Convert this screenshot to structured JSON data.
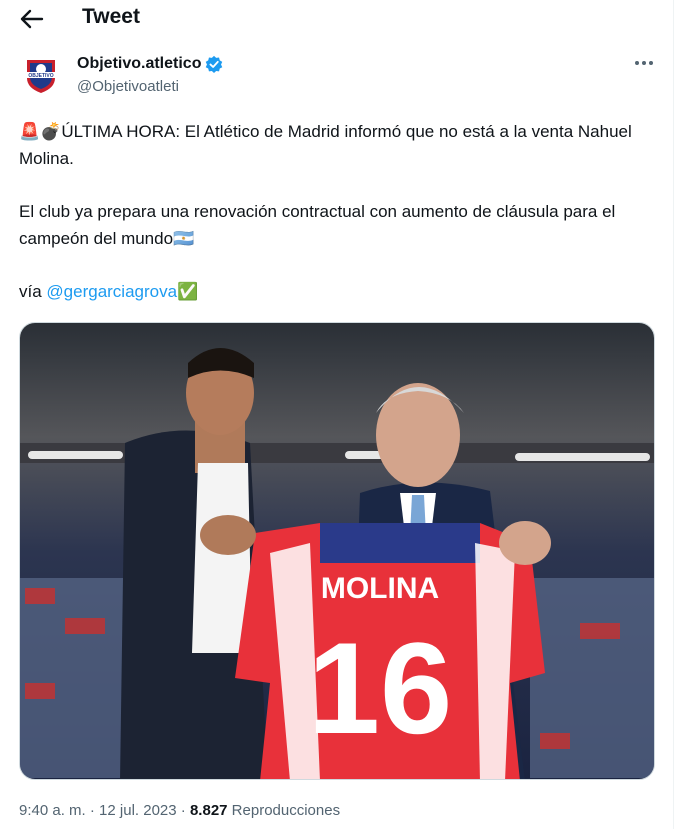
{
  "header": {
    "title": "Tweet",
    "back_icon": "arrow-left-icon"
  },
  "author": {
    "name": "Objetivo.atletico",
    "handle": "@Objetivoatleti",
    "verified_icon": "verified-badge-icon",
    "avatar_text": "OBJETIVO"
  },
  "tweet": {
    "line1_emoji": "🚨💣",
    "line1_text": "ÚLTIMA HORA: El Atlético de Madrid informó que no está a la venta Nahuel Molina.",
    "line2_text": "El club ya prepara una renovación contractual con aumento de cláusula para el campeón del mundo",
    "line2_emoji": "🇦🇷",
    "via_label": "vía ",
    "via_link": "@gergarciagrova",
    "via_emoji": "✅"
  },
  "media": {
    "jersey_name": "MOLINA",
    "jersey_number": "16"
  },
  "footer": {
    "time": "9:40 a. m.",
    "sep1": " · ",
    "date": "12 jul. 2023",
    "sep2": " · ",
    "views_count": "8.827",
    "views_label": " Reproducciones"
  },
  "colors": {
    "accent": "#1d9bf0",
    "text": "#0f1419",
    "muted": "#536471",
    "jersey_red": "#e8313a"
  }
}
